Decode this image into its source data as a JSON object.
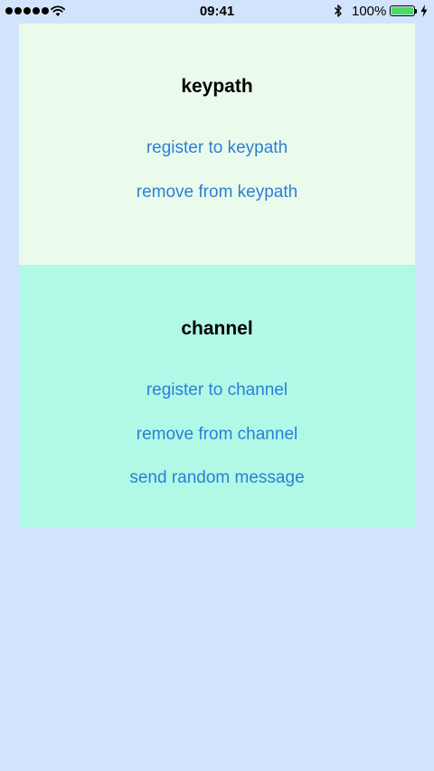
{
  "status_bar": {
    "time": "09:41",
    "battery_percent": "100%",
    "signal_bars": 5,
    "icons": [
      "signal-dots-icon",
      "wifi-icon",
      "bluetooth-icon",
      "battery-icon",
      "charging-bolt-icon"
    ]
  },
  "keypath": {
    "title": "keypath",
    "register_label": "register to keypath",
    "remove_label": "remove from keypath"
  },
  "channel": {
    "title": "channel",
    "register_label": "register to channel",
    "remove_label": "remove from channel",
    "send_label": "send random message"
  },
  "colors": {
    "background": "#d2e4fc",
    "keypath_panel": "#ebfbeb",
    "channel_panel": "#b1f8e6",
    "link": "#2b7fd6",
    "battery_fill": "#4cd964"
  }
}
